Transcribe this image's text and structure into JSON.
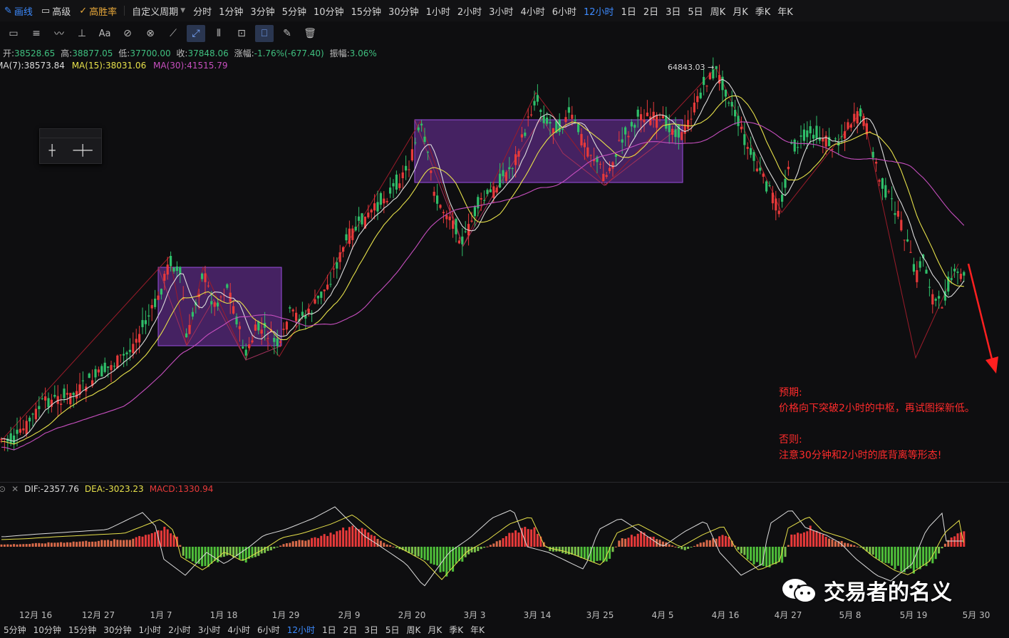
{
  "topbar": {
    "draw": "画线",
    "advanced": "高级",
    "winrate": "高胜率",
    "custom_period": "自定义周期",
    "periods": [
      "分时",
      "1分钟",
      "3分钟",
      "5分钟",
      "10分钟",
      "15分钟",
      "30分钟",
      "1小时",
      "2小时",
      "3小时",
      "4小时",
      "6小时",
      "12小时",
      "1日",
      "2日",
      "3日",
      "5日",
      "周K",
      "月K",
      "季K",
      "年K"
    ],
    "active_period": "12小时"
  },
  "info": {
    "open_label": "开:",
    "open": "38528.65",
    "high_label": "高:",
    "high": "38877.05",
    "low_label": "低:",
    "low": "37700.00",
    "close_label": "收:",
    "close": "37848.06",
    "change_label": "涨幅:",
    "change": "-1.76%(-677.40)",
    "amp_label": "振幅:",
    "amp": "3.06%"
  },
  "ma": {
    "ma7": "MA(7):38573.84",
    "ma15": "MA(15):38031.06",
    "ma30": "MA(30):41515.79"
  },
  "max_price_label": "64843.03 →",
  "macd": {
    "dif": "DIF:-2357.76",
    "dea": "DEA:-3023.23",
    "macd": "MACD:1330.94"
  },
  "x_axis": [
    "12月 16",
    "12月 27",
    "1月 7",
    "1月 18",
    "1月 29",
    "2月 9",
    "2月 20",
    "3月 3",
    "3月 14",
    "3月 25",
    "4月 5",
    "4月 16",
    "4月 27",
    "5月 8",
    "5月 19",
    "5月 30"
  ],
  "bottombar": {
    "periods": [
      "5分钟",
      "10分钟",
      "15分钟",
      "30分钟",
      "1小时",
      "2小时",
      "3小时",
      "4小时",
      "6小时",
      "12小时",
      "1日",
      "2日",
      "3日",
      "5日",
      "周K",
      "月K",
      "季K",
      "年K"
    ],
    "active_period": "12小时"
  },
  "annotation": {
    "line1": "预期:",
    "line2": "价格向下突破2小时的中枢，再试图探新低。",
    "line3": "否则:",
    "line4": "注意30分钟和2小时的底背离等形态!"
  },
  "watermark": "交易者的名义",
  "colors": {
    "up": "#e83a3a",
    "down": "#2fbf6a",
    "ma7": "#dcdcdc",
    "ma15": "#e6e04a",
    "ma30": "#c74fbf",
    "box": "#8a3cc8",
    "accent": "#3d8bff"
  },
  "chart_data": {
    "type": "candlestick",
    "x": [
      "12月 16",
      "12月 27",
      "1月 7",
      "1月 18",
      "1月 29",
      "2月 9",
      "2月 20",
      "3月 3",
      "3月 14",
      "3月 25",
      "4月 5",
      "4月 16",
      "4月 27",
      "5月 8",
      "5月 19",
      "5月 30"
    ],
    "close_trend": [
      22000,
      26500,
      33500,
      31000,
      30000,
      36500,
      43500,
      39000,
      48000,
      46000,
      49000,
      50000,
      45000,
      55000,
      38500,
      37848
    ],
    "max_price": 64843.03,
    "series": [
      {
        "name": "MA(7)",
        "last": 38573.84
      },
      {
        "name": "MA(15)",
        "last": 38031.06
      },
      {
        "name": "MA(30)",
        "last": 41515.79
      }
    ]
  }
}
